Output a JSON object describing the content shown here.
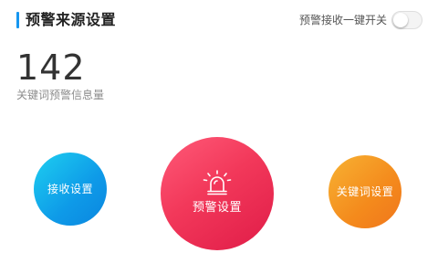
{
  "header": {
    "title": "预警来源设置",
    "accent_color": "#1696f0"
  },
  "toggle": {
    "label": "预警接收一键开关",
    "on": false
  },
  "stats": {
    "value": "142",
    "label": "关键词预警信息量"
  },
  "actions": {
    "receive": {
      "label": "接收设置",
      "color": "#0e9ae8"
    },
    "alert": {
      "label": "预警设置",
      "icon": "alarm-light-icon",
      "color": "#f2385a"
    },
    "keywords": {
      "label": "关键词设置",
      "color": "#f48a1c"
    }
  }
}
